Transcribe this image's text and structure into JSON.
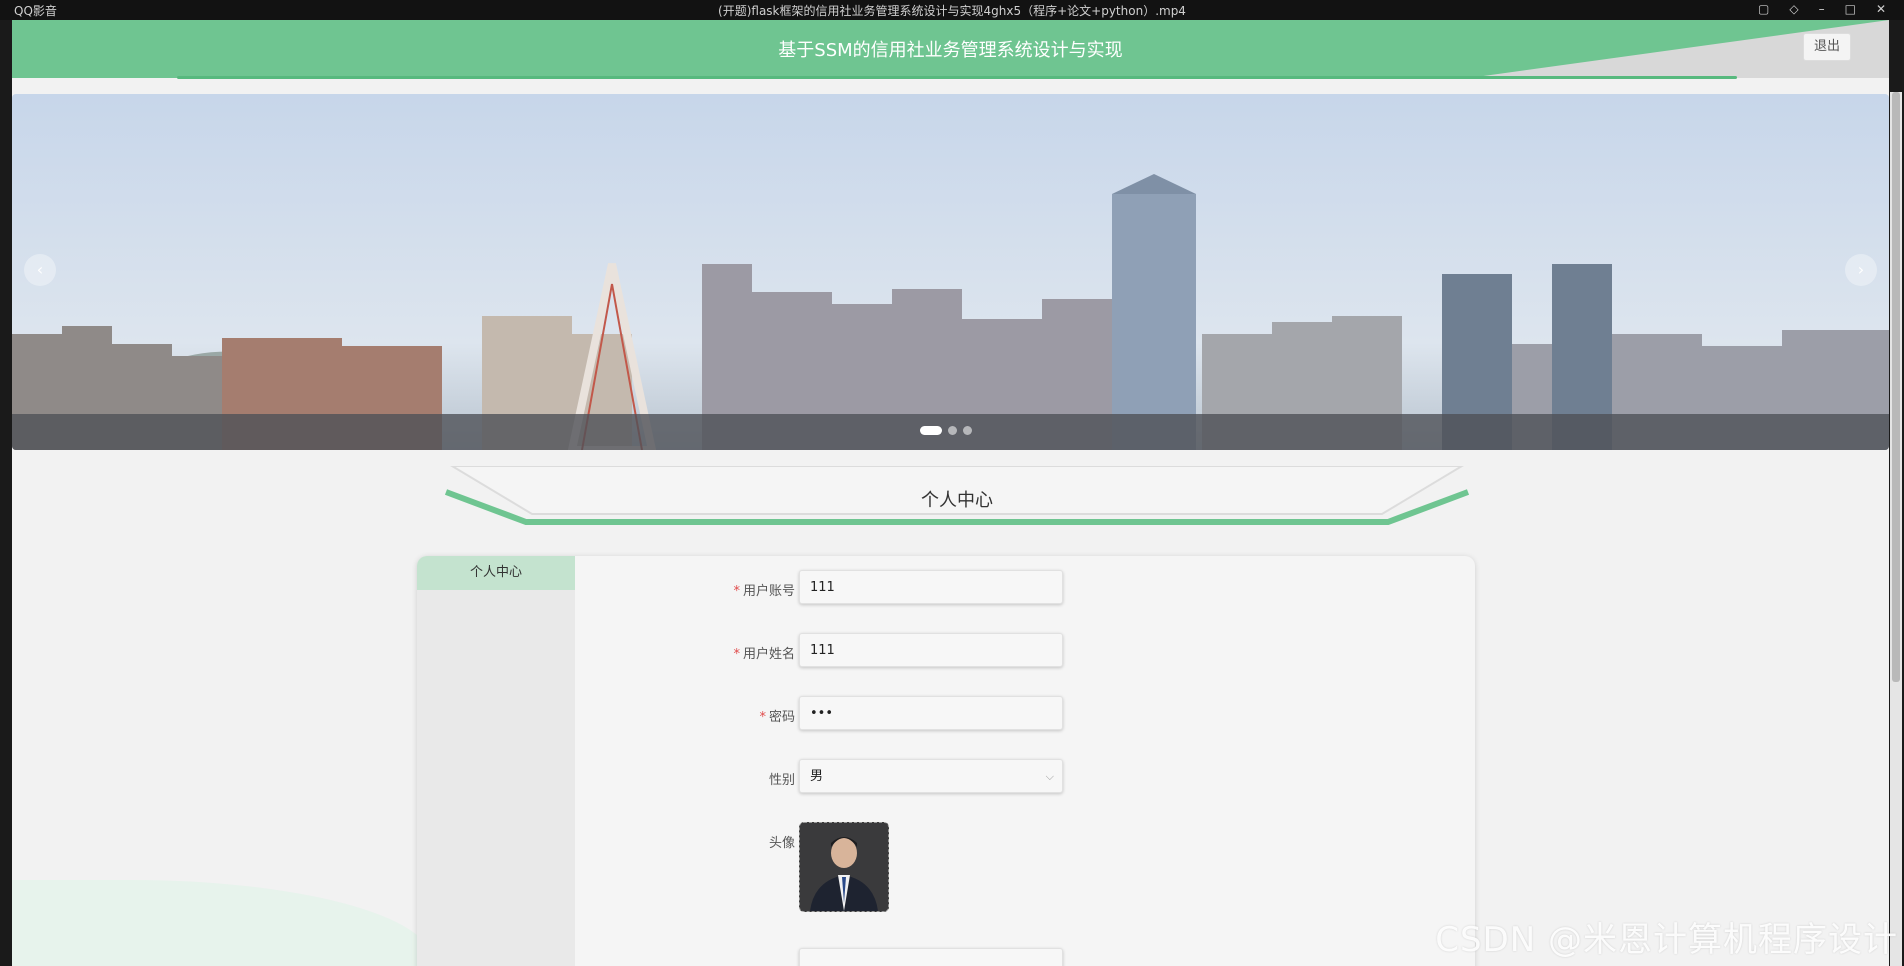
{
  "player": {
    "brand": "QQ影音",
    "file_title": "(开题)flask框架的信用社业务管理系统设计与实现4ghx5（程序+论文+python）.mp4"
  },
  "header": {
    "title": "基于SSM的信用社业务管理系统设计与实现",
    "logout_label": "退出"
  },
  "carousel": {
    "prev_icon": "chevron-left-icon",
    "next_icon": "chevron-right-icon",
    "prev_glyph": "‹",
    "next_glyph": "›",
    "slide_count": 3,
    "active_slide": 1
  },
  "section": {
    "title": "个人中心"
  },
  "sidebar": {
    "items": [
      {
        "label": "个人中心",
        "active": true
      }
    ]
  },
  "form": {
    "fields": [
      {
        "label": "用户账号",
        "required": true,
        "value": "111"
      },
      {
        "label": "用户姓名",
        "required": true,
        "value": "111"
      },
      {
        "label": "密码",
        "required": true,
        "value": "•••"
      },
      {
        "label": "性别",
        "required": false,
        "value": "男"
      },
      {
        "label": "头像",
        "required": false
      }
    ]
  },
  "watermark": "CSDN @米恩计算机程序设计",
  "colors": {
    "accent": "#6fc591",
    "accent_dark": "#57b97e",
    "tab_active": "#c4e3cf",
    "required": "#e04a4a"
  }
}
